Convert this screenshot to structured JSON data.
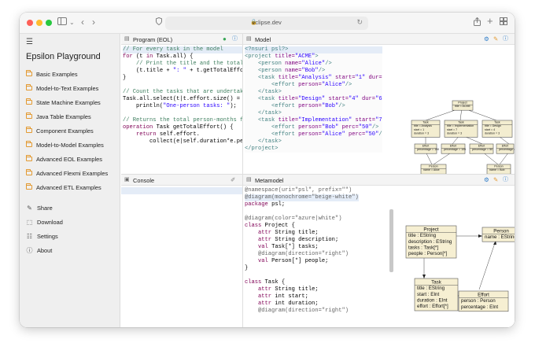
{
  "browser": {
    "url": "eclipse.dev",
    "icons": [
      "sidebar-toggle-icon",
      "chevron-down-icon",
      "back-icon",
      "forward-icon",
      "shield-icon",
      "reload-icon",
      "share-icon",
      "new-tab-icon",
      "tab-overview-icon"
    ]
  },
  "sidebar": {
    "title": "Epsilon Playground",
    "examples": [
      {
        "label": "Basic Examples"
      },
      {
        "label": "Model-to-Text Examples"
      },
      {
        "label": "State Machine Examples"
      },
      {
        "label": "Java Table Examples"
      },
      {
        "label": "Component Examples"
      },
      {
        "label": "Model-to-Model Examples"
      },
      {
        "label": "Advanced EOL Examples"
      },
      {
        "label": "Advanced Flexmi Examples"
      },
      {
        "label": "Advanced ETL Examples"
      }
    ],
    "actions": [
      {
        "label": "Share",
        "icon": "share-icon"
      },
      {
        "label": "Download",
        "icon": "download-icon"
      },
      {
        "label": "Settings",
        "icon": "settings-icon"
      },
      {
        "label": "About",
        "icon": "info-icon"
      }
    ]
  },
  "program_panel": {
    "title": "Program (EOL)",
    "lines": [
      [
        [
          "// For every task in the model",
          "cm"
        ]
      ],
      [
        [
          "for",
          "kw"
        ],
        [
          " (t ",
          ""
        ],
        [
          "in",
          "kw"
        ],
        [
          " Task.all) {",
          ""
        ]
      ],
      [
        [
          "    // Print the title and the total",
          "cm"
        ]
      ],
      [
        [
          "    (t.title + ",
          ""
        ],
        [
          "\": \"",
          "st"
        ],
        [
          " + t.getTotalEffor",
          ""
        ]
      ],
      [
        [
          "}",
          ""
        ]
      ],
      [
        [
          "",
          ""
        ]
      ],
      [
        [
          "// Count the tasks that are undertake",
          "cm"
        ]
      ],
      [
        [
          "Task.all.select(t|t.effort.size() = 1",
          ""
        ]
      ],
      [
        [
          "    println(",
          ""
        ],
        [
          "\"One-person tasks: \"",
          "st"
        ],
        [
          ");",
          ""
        ]
      ],
      [
        [
          "",
          ""
        ]
      ],
      [
        [
          "// Returns the total person-months fo",
          "cm"
        ]
      ],
      [
        [
          "operation",
          "kw"
        ],
        [
          " Task getTotalEffort() {",
          ""
        ]
      ],
      [
        [
          "    ",
          ""
        ],
        [
          "return",
          "kw"
        ],
        [
          " self.effort.",
          ""
        ]
      ],
      [
        [
          "        collect(e|self.duration*e.per",
          ""
        ]
      ]
    ]
  },
  "model_panel": {
    "title": "Model",
    "lines": [
      [
        [
          "<?nsuri psl?>",
          "tg"
        ]
      ],
      [
        [
          "<project ",
          "tg"
        ],
        [
          "title=",
          "at"
        ],
        [
          "\"ACME\"",
          "st"
        ],
        [
          ">",
          "tg"
        ]
      ],
      [
        [
          "    <person ",
          "tg"
        ],
        [
          "name=",
          "at"
        ],
        [
          "\"Alice\"",
          "st"
        ],
        [
          "/>",
          "tg"
        ]
      ],
      [
        [
          "    <person ",
          "tg"
        ],
        [
          "name=",
          "at"
        ],
        [
          "\"Bob\"",
          "st"
        ],
        [
          "/>",
          "tg"
        ]
      ],
      [
        [
          "    <task ",
          "tg"
        ],
        [
          "title=",
          "at"
        ],
        [
          "\"Analysis\"",
          "st"
        ],
        [
          " start=",
          "at"
        ],
        [
          "\"1\"",
          "st"
        ],
        [
          " dur=",
          "at"
        ]
      ],
      [
        [
          "        <effort ",
          "tg"
        ],
        [
          "person=",
          "at"
        ],
        [
          "\"Alice\"",
          "st"
        ],
        [
          "/>",
          "tg"
        ]
      ],
      [
        [
          "    </task>",
          "tg"
        ]
      ],
      [
        [
          "    <task ",
          "tg"
        ],
        [
          "title=",
          "at"
        ],
        [
          "\"Design\"",
          "st"
        ],
        [
          " start=",
          "at"
        ],
        [
          "\"4\"",
          "st"
        ],
        [
          " dur=",
          "at"
        ],
        [
          "\"6",
          "st"
        ]
      ],
      [
        [
          "        <effort ",
          "tg"
        ],
        [
          "person=",
          "at"
        ],
        [
          "\"Bob\"",
          "st"
        ],
        [
          "/>",
          "tg"
        ]
      ],
      [
        [
          "    </task>",
          "tg"
        ]
      ],
      [
        [
          "    <task ",
          "tg"
        ],
        [
          "title=",
          "at"
        ],
        [
          "\"Implementation\"",
          "st"
        ],
        [
          " start=",
          "at"
        ],
        [
          "\"7",
          "st"
        ]
      ],
      [
        [
          "        <effort ",
          "tg"
        ],
        [
          "person=",
          "at"
        ],
        [
          "\"Bob\"",
          "st"
        ],
        [
          " perc=",
          "at"
        ],
        [
          "\"50\"",
          "st"
        ],
        [
          "/>",
          "tg"
        ]
      ],
      [
        [
          "        <effort ",
          "tg"
        ],
        [
          "person=",
          "at"
        ],
        [
          "\"Alice\"",
          "st"
        ],
        [
          " perc=",
          "at"
        ],
        [
          "\"50\"",
          "st"
        ],
        [
          "/",
          "tg"
        ]
      ],
      [
        [
          "    </task>",
          "tg"
        ]
      ],
      [
        [
          "</project>",
          "tg"
        ]
      ]
    ],
    "diagram": {
      "project": [
        "Project",
        "title = ACME"
      ],
      "tasks": [
        [
          "Task",
          "title = Analysis",
          "start = 1",
          "duration = 3"
        ],
        [
          "Task",
          "title = Implementation",
          "start = 7",
          "duration = 3"
        ],
        [
          "Task",
          "title = Design",
          "start = 4",
          "duration = 3"
        ]
      ],
      "efforts": [
        [
          "Effort",
          "percentage = 100"
        ],
        [
          "Effort",
          "percentage = 100"
        ],
        [
          "Effort",
          "percentage = 50"
        ],
        [
          "Effort",
          "percentage = 50"
        ]
      ],
      "persons": [
        [
          "Person",
          "name = Alice"
        ],
        [
          "Person",
          "name = Bob"
        ]
      ]
    }
  },
  "console_panel": {
    "title": "Console"
  },
  "metamodel_panel": {
    "title": "Metamodel",
    "lines": [
      [
        [
          "@namespace(uri=\"psl\", prefix=\"\")",
          "an"
        ]
      ],
      [
        [
          "@diagram(monochrome=\"beige-white\")",
          "an"
        ]
      ],
      [
        [
          "package",
          "mu"
        ],
        [
          " psl;",
          ""
        ]
      ],
      [
        [
          "",
          ""
        ]
      ],
      [
        [
          "@diagram(color=\"azure|white\")",
          "an"
        ]
      ],
      [
        [
          "class",
          "mu"
        ],
        [
          " Project {",
          ""
        ]
      ],
      [
        [
          "    ",
          ""
        ],
        [
          "attr",
          "mu"
        ],
        [
          " String title;",
          ""
        ]
      ],
      [
        [
          "    ",
          ""
        ],
        [
          "attr",
          "mu"
        ],
        [
          " String description;",
          ""
        ]
      ],
      [
        [
          "    ",
          ""
        ],
        [
          "val",
          "mu"
        ],
        [
          " Task[*] tasks;",
          ""
        ]
      ],
      [
        [
          "    @diagram(direction=\"right\")",
          "an"
        ]
      ],
      [
        [
          "    ",
          ""
        ],
        [
          "val",
          "mu"
        ],
        [
          " Person[*] people;",
          ""
        ]
      ],
      [
        [
          "}",
          ""
        ]
      ],
      [
        [
          "",
          ""
        ]
      ],
      [
        [
          "class",
          "mu"
        ],
        [
          " Task {",
          ""
        ]
      ],
      [
        [
          "    ",
          ""
        ],
        [
          "attr",
          "mu"
        ],
        [
          " String title;",
          ""
        ]
      ],
      [
        [
          "    ",
          ""
        ],
        [
          "attr",
          "mu"
        ],
        [
          " int start;",
          ""
        ]
      ],
      [
        [
          "    ",
          ""
        ],
        [
          "attr",
          "mu"
        ],
        [
          " int duration;",
          ""
        ]
      ],
      [
        [
          "    @diagram(direction=\"right\")",
          "an"
        ]
      ]
    ],
    "diagram": {
      "project": {
        "name": "Project",
        "attrs": [
          "title : EString",
          "description : EString",
          "tasks : Task[*]",
          "people : Person[*]"
        ]
      },
      "person": {
        "name": "Person",
        "attrs": [
          "name : EString"
        ]
      },
      "task": {
        "name": "Task",
        "attrs": [
          "title : EString",
          "start : EInt",
          "duration : EInt",
          "effort : Effort[*]"
        ]
      },
      "effort": {
        "name": "Effort",
        "attrs": [
          "person : Person",
          "percentage : EInt"
        ]
      }
    }
  },
  "colors": {
    "accent": "#2a7ac7",
    "run_button": "#3aa757",
    "folder": "#e39a32",
    "metamodel_box": "#f6efd2",
    "model_box": "#f3edd0"
  }
}
